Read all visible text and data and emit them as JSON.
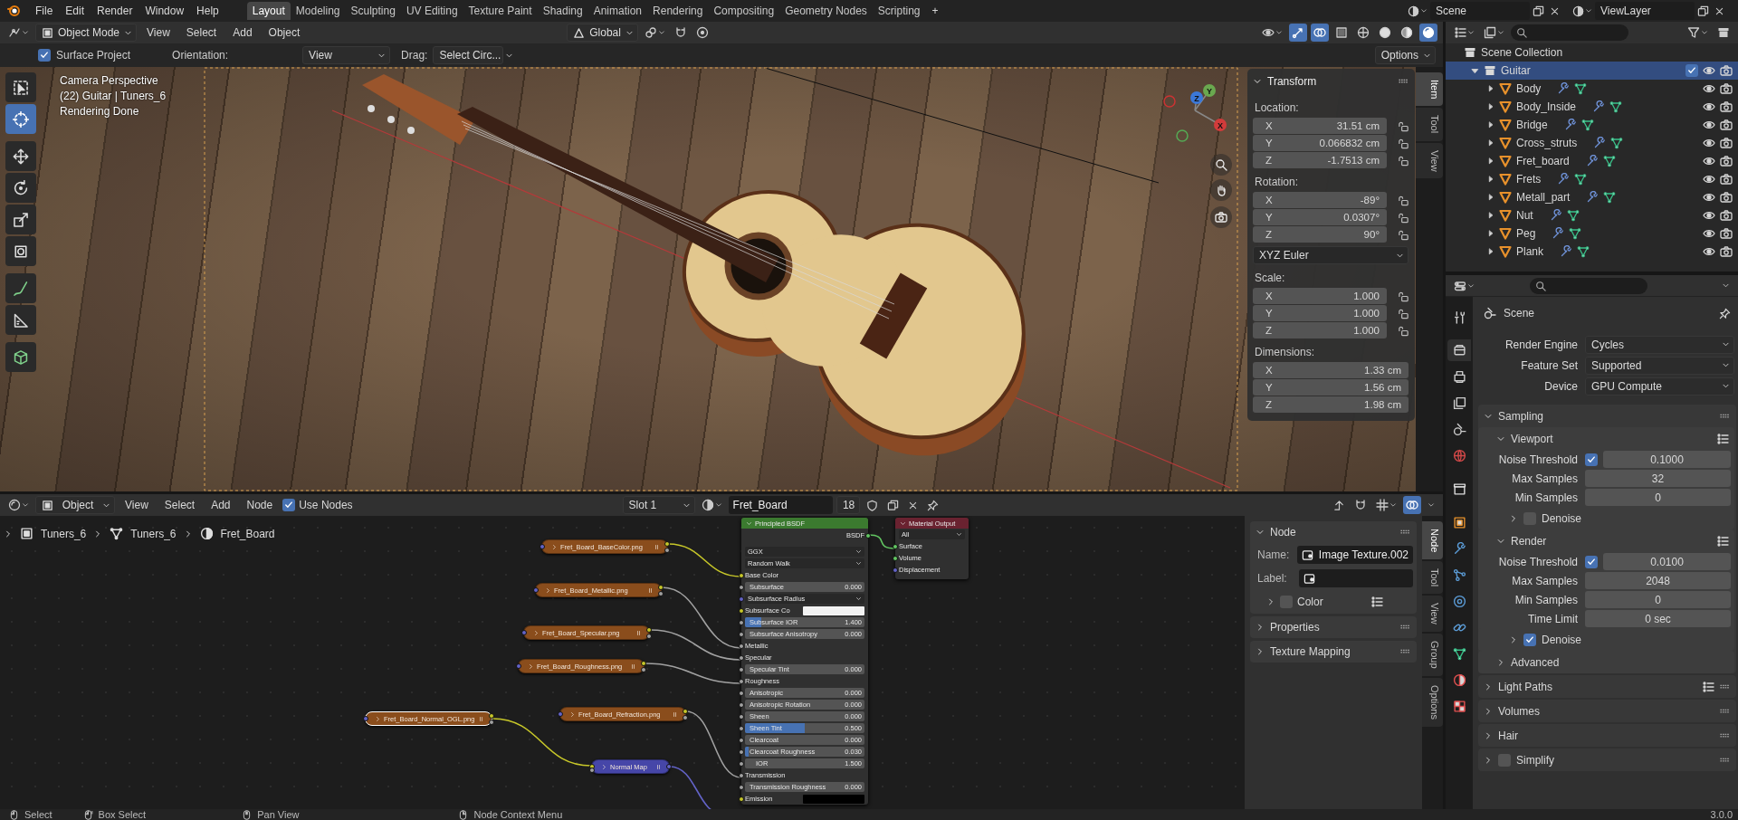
{
  "topbar": {
    "menus": [
      "File",
      "Edit",
      "Render",
      "Window",
      "Help"
    ],
    "workspaces": [
      {
        "label": "Layout",
        "selected": true
      },
      {
        "label": "Modeling",
        "selected": false
      },
      {
        "label": "Sculpting",
        "selected": false
      },
      {
        "label": "UV Editing",
        "selected": false
      },
      {
        "label": "Texture Paint",
        "selected": false
      },
      {
        "label": "Shading",
        "selected": false
      },
      {
        "label": "Animation",
        "selected": false
      },
      {
        "label": "Rendering",
        "selected": false
      },
      {
        "label": "Compositing",
        "selected": false
      },
      {
        "label": "Geometry Nodes",
        "selected": false
      },
      {
        "label": "Scripting",
        "selected": false
      }
    ],
    "add_workspace": "+",
    "scene": "Scene",
    "view_layer": "ViewLayer"
  },
  "viewport": {
    "mode": "Object Mode",
    "menus": [
      "View",
      "Select",
      "Add",
      "Object"
    ],
    "orientation": "Global",
    "gizmos": true,
    "overlays": true,
    "xray": false,
    "shading": [
      {
        "kind": "wireframe",
        "selected": false
      },
      {
        "kind": "solid",
        "selected": false
      },
      {
        "kind": "material",
        "selected": false
      },
      {
        "kind": "rendered",
        "selected": true
      }
    ],
    "surface_project": {
      "label": "Surface Project",
      "checked": true
    },
    "orientation_label": "Orientation:",
    "orientation_value": "View",
    "drag_label": "Drag:",
    "drag_value": "Select Circ...",
    "options": "Options",
    "tools": [
      {
        "kind": "select",
        "selected": false
      },
      {
        "kind": "cursor",
        "selected": true
      },
      {
        "kind": "move",
        "selected": false
      },
      {
        "kind": "rotate",
        "selected": false
      },
      {
        "kind": "scale",
        "selected": false
      },
      {
        "kind": "transform",
        "selected": false
      },
      {
        "kind": "annotate",
        "selected": false
      },
      {
        "kind": "measure",
        "selected": false
      },
      {
        "kind": "add_cube",
        "selected": false
      }
    ],
    "info": [
      "Camera Perspective",
      "(22) Guitar | Tuners_6",
      "Rendering Done"
    ],
    "gizmo_axes": [
      "X",
      "Y",
      "Z"
    ],
    "sidebar": {
      "tabs": [
        {
          "label": "Item",
          "selected": true
        },
        {
          "label": "Tool",
          "selected": false
        },
        {
          "label": "View",
          "selected": false
        }
      ],
      "panel": {
        "title": "Transform",
        "expanded": true,
        "groups": [
          {
            "label": "Location:",
            "fields": [
              {
                "axis": "X",
                "value": "31.51 cm",
                "locked": false
              },
              {
                "axis": "Y",
                "value": "0.066832 cm",
                "locked": false
              },
              {
                "axis": "Z",
                "value": "-1.7513 cm",
                "locked": false
              }
            ]
          },
          {
            "label": "Rotation:",
            "fields": [
              {
                "axis": "X",
                "value": "-89°",
                "locked": false
              },
              {
                "axis": "Y",
                "value": "0.0307°",
                "locked": false
              },
              {
                "axis": "Z",
                "value": "90°",
                "locked": false
              }
            ],
            "mode": "XYZ Euler"
          },
          {
            "label": "Scale:",
            "fields": [
              {
                "axis": "X",
                "value": "1.000",
                "locked": false
              },
              {
                "axis": "Y",
                "value": "1.000",
                "locked": false
              },
              {
                "axis": "Z",
                "value": "1.000",
                "locked": false
              }
            ]
          },
          {
            "label": "Dimensions:",
            "fields": [
              {
                "axis": "X",
                "value": "1.33 cm"
              },
              {
                "axis": "Y",
                "value": "1.56 cm"
              },
              {
                "axis": "Z",
                "value": "1.98 cm"
              }
            ]
          }
        ]
      }
    }
  },
  "node_editor": {
    "data_type": "Object",
    "menus": [
      "View",
      "Select",
      "Add",
      "Node"
    ],
    "use_nodes": {
      "label": "Use Nodes",
      "checked": true
    },
    "slot": "Slot 1",
    "material": "Fret_Board",
    "users": "18",
    "breadcrumbs": [
      {
        "kind": "object",
        "label": "Tuners_6"
      },
      {
        "kind": "mesh",
        "label": "Tuners_6"
      },
      {
        "kind": "material",
        "label": "Fret_Board"
      }
    ],
    "nodes": [
      {
        "kind": "image",
        "label": "Fret_Board_BaseColor.png",
        "selected": false
      },
      {
        "kind": "image",
        "label": "Fret_Board_Metallic.png",
        "selected": false
      },
      {
        "kind": "image",
        "label": "Fret_Board_Specular.png",
        "selected": false
      },
      {
        "kind": "image",
        "label": "Fret_Board_Roughness.png",
        "selected": false
      },
      {
        "kind": "image",
        "label": "Fret_Board_Refraction.png",
        "selected": false
      },
      {
        "kind": "image",
        "label": "Fret_Board_Normal_OGL.png",
        "selected": true
      },
      {
        "kind": "normal_map",
        "label": "Normal Map",
        "selected": false
      }
    ],
    "principled": {
      "title": "Principled BSDF",
      "output": "BSDF",
      "rows": [
        {
          "kind": "dropdown",
          "label": "GGX"
        },
        {
          "kind": "dropdown",
          "label": "Random Walk"
        },
        {
          "kind": "color_socket",
          "label": "Base Color"
        },
        {
          "kind": "slider",
          "label": "Subsurface",
          "value": "0.000",
          "level": 0
        },
        {
          "kind": "vector_dropdown",
          "label": "Subsurface Radius"
        },
        {
          "kind": "color",
          "label": "Subsurface Co",
          "color": "#f2f2f2"
        },
        {
          "kind": "slider",
          "label": "Subsurface IOR",
          "value": "1.400",
          "level": 0.14
        },
        {
          "kind": "slider",
          "label": "Subsurface Anisotropy",
          "value": "0.000",
          "level": 0
        },
        {
          "kind": "float_socket",
          "label": "Metallic"
        },
        {
          "kind": "float_socket",
          "label": "Specular"
        },
        {
          "kind": "slider",
          "label": "Specular Tint",
          "value": "0.000",
          "level": 0
        },
        {
          "kind": "float_socket",
          "label": "Roughness"
        },
        {
          "kind": "slider",
          "label": "Anisotropic",
          "value": "0.000",
          "level": 0
        },
        {
          "kind": "slider",
          "label": "Anisotropic Rotation",
          "value": "0.000",
          "level": 0
        },
        {
          "kind": "slider",
          "label": "Sheen",
          "value": "0.000",
          "level": 0
        },
        {
          "kind": "slider",
          "label": "Sheen Tint",
          "value": "0.500",
          "level": 0.5
        },
        {
          "kind": "slider",
          "label": "Clearcoat",
          "value": "0.000",
          "level": 0
        },
        {
          "kind": "slider",
          "label": "Clearcoat Roughness",
          "value": "0.030",
          "level": 0.03
        },
        {
          "kind": "number",
          "label": "IOR",
          "value": "1.500"
        },
        {
          "kind": "float_socket",
          "label": "Transmission"
        },
        {
          "kind": "slider",
          "label": "Transmission Roughness",
          "value": "0.000",
          "level": 0
        },
        {
          "kind": "color",
          "label": "Emission",
          "color": "#000000"
        }
      ]
    },
    "material_output": {
      "title": "Material Output",
      "target": "All",
      "inputs": [
        {
          "kind": "shader",
          "label": "Surface"
        },
        {
          "kind": "shader",
          "label": "Volume"
        },
        {
          "kind": "vector",
          "label": "Displacement"
        }
      ]
    },
    "sidebar": {
      "tabs": [
        {
          "label": "Node",
          "selected": true
        },
        {
          "label": "Tool",
          "selected": false
        },
        {
          "label": "View",
          "selected": false
        },
        {
          "label": "Group",
          "selected": false
        },
        {
          "label": "Options",
          "selected": false
        }
      ],
      "panels": [
        {
          "title": "Node",
          "expanded": true,
          "name_label": "Name:",
          "name": "Image Texture.002",
          "label_label": "Label:",
          "color": {
            "label": "Color",
            "checked": false,
            "expanded": false
          }
        },
        {
          "title": "Properties",
          "expanded": false
        },
        {
          "title": "Texture Mapping",
          "expanded": false
        }
      ]
    }
  },
  "outliner": {
    "root": "Scene Collection",
    "collections": [
      {
        "label": "Guitar",
        "selected": true,
        "expanded": true,
        "checked": true,
        "children": [
          {
            "label": "Body",
            "selected": false,
            "expanded": false
          },
          {
            "label": "Body_Inside",
            "selected": false,
            "expanded": false
          },
          {
            "label": "Bridge",
            "selected": false,
            "expanded": false
          },
          {
            "label": "Cross_struts",
            "selected": false,
            "expanded": false
          },
          {
            "label": "Fret_board",
            "selected": false,
            "expanded": false
          },
          {
            "label": "Frets",
            "selected": false,
            "expanded": false
          },
          {
            "label": "Metall_part",
            "selected": false,
            "expanded": false
          },
          {
            "label": "Nut",
            "selected": false,
            "expanded": false
          },
          {
            "label": "Peg",
            "selected": false,
            "expanded": false
          },
          {
            "label": "Plank",
            "selected": false,
            "expanded": false
          }
        ]
      }
    ]
  },
  "properties": {
    "tabs": [
      {
        "kind": "tool",
        "selected": false
      },
      {
        "kind": "render",
        "selected": true
      },
      {
        "kind": "output",
        "selected": false
      },
      {
        "kind": "view_layer",
        "selected": false
      },
      {
        "kind": "scene",
        "selected": false
      },
      {
        "kind": "world",
        "selected": false
      },
      {
        "kind": "collection",
        "selected": false
      },
      {
        "kind": "object",
        "selected": false
      },
      {
        "kind": "modifiers",
        "selected": false
      },
      {
        "kind": "particles",
        "selected": false
      },
      {
        "kind": "physics",
        "selected": false
      },
      {
        "kind": "constraints",
        "selected": false
      },
      {
        "kind": "data",
        "selected": false
      },
      {
        "kind": "material",
        "selected": false
      },
      {
        "kind": "texture",
        "selected": false
      }
    ],
    "context": "Scene",
    "fields": [
      {
        "label": "Render Engine",
        "value": "Cycles"
      },
      {
        "label": "Feature Set",
        "value": "Supported"
      },
      {
        "label": "Device",
        "value": "GPU Compute"
      }
    ],
    "panels": [
      {
        "title": "Sampling",
        "expanded": true,
        "items": [
          {
            "kind": "panel",
            "title": "Viewport",
            "expanded": true,
            "presets": true,
            "items": [
              {
                "kind": "field",
                "label": "Noise Threshold",
                "checked": true,
                "value": "0.1000"
              },
              {
                "kind": "field",
                "label": "Max Samples",
                "value": "32"
              },
              {
                "kind": "field",
                "label": "Min Samples",
                "value": "0"
              },
              {
                "kind": "panel",
                "title": "Denoise",
                "expanded": false,
                "checked": false
              }
            ]
          },
          {
            "kind": "panel",
            "title": "Render",
            "expanded": true,
            "presets": true,
            "items": [
              {
                "kind": "field",
                "label": "Noise Threshold",
                "checked": true,
                "value": "0.0100"
              },
              {
                "kind": "field",
                "label": "Max Samples",
                "value": "2048"
              },
              {
                "kind": "field",
                "label": "Min Samples",
                "value": "0"
              },
              {
                "kind": "field",
                "label": "Time Limit",
                "value": "0 sec"
              },
              {
                "kind": "panel",
                "title": "Denoise",
                "expanded": false,
                "checked": true
              }
            ]
          },
          {
            "kind": "panel",
            "title": "Advanced",
            "expanded": false
          }
        ]
      },
      {
        "title": "Light Paths",
        "expanded": false,
        "presets": true
      },
      {
        "title": "Volumes",
        "expanded": false
      },
      {
        "title": "Hair",
        "expanded": false
      },
      {
        "title": "Simplify",
        "expanded": false,
        "checked": false
      }
    ]
  },
  "status_bar": {
    "hints": [
      {
        "kind": "left",
        "label": "Select"
      },
      {
        "kind": "box",
        "label": "Box Select"
      },
      {
        "kind": "middle",
        "label": "Pan View"
      },
      {
        "kind": "right",
        "label": "Node Context Menu"
      }
    ],
    "version": "3.0.0"
  }
}
